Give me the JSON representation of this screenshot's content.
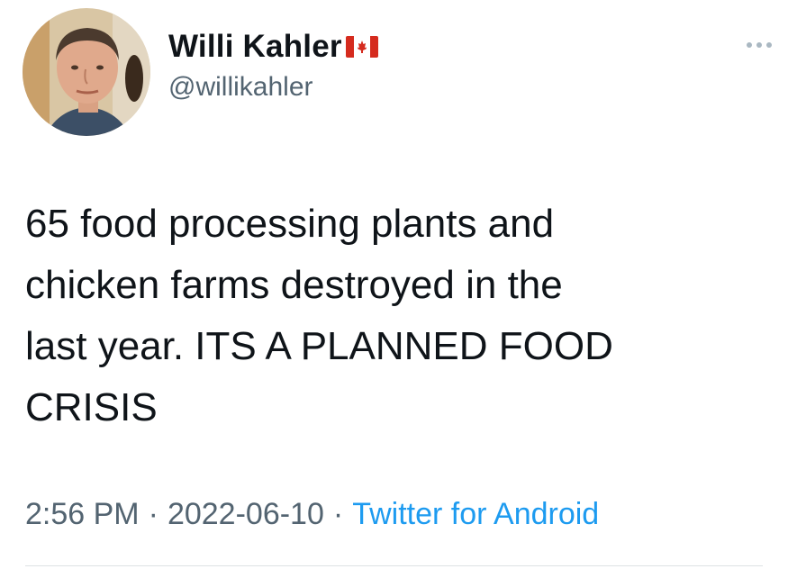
{
  "user": {
    "display_name": "Willi Kahler",
    "handle": "@willikahler",
    "flag_icon": "canada-flag-icon"
  },
  "tweet": {
    "text": "65 food processing plants and\nchicken farms destroyed in the\nlast year. ITS A PLANNED FOOD\nCRISIS"
  },
  "meta": {
    "time": "2:56 PM",
    "separator": "·",
    "date": "2022-06-10",
    "source": "Twitter for Android"
  },
  "icons": {
    "more": "more-options-icon"
  },
  "colors": {
    "text": "#0f1419",
    "secondary": "#536471",
    "link": "#1d9bf0",
    "flag_red": "#d52b1e"
  }
}
